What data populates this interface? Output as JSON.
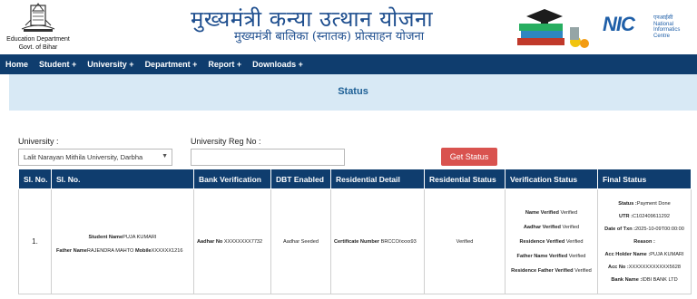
{
  "header": {
    "dept_line1": "Education Department",
    "dept_line2": "Govt. of Bihar",
    "title_main": "मुख्यमंत्री कन्या उत्थान योजना",
    "title_sub": "मुख्यमंत्री बालिका (स्नातक) प्रोत्साहन योजना",
    "nic_logo": "NIC",
    "nic_hindi": "एनआईसी",
    "nic_line1": "National",
    "nic_line2": "Informatics",
    "nic_line3": "Centre"
  },
  "nav": {
    "items": [
      "Home",
      "Student +",
      "University +",
      "Department +",
      "Report +",
      "Downloads +"
    ]
  },
  "page": {
    "title": "Status"
  },
  "form": {
    "university_label": "University :",
    "university_selected": "Lalit Narayan Mithila University, Darbha",
    "reg_label": "University Reg No :",
    "reg_value": "",
    "button": "Get Status"
  },
  "table": {
    "headers": [
      "Sl. No.",
      "Sl. No.",
      "Bank Verification",
      "DBT Enabled",
      "Residential Detail",
      "Residential Status",
      "Verification Status",
      "Final Status"
    ],
    "row": {
      "sl": "1.",
      "student_name_label": "Student Name",
      "student_name": "PUJA KUMARI",
      "father_name_label": "Father Name",
      "father_name": "RAJENDRA MAHTO",
      "mobile_label": "Mobile",
      "mobile": "XXXXXX1216",
      "aadhar_label": "Aadhar No",
      "aadhar": "XXXXXXXX7732",
      "dbt": "Aadhar Seeded",
      "cert_label": "Certificate Number",
      "cert": "BRCCO/xxxx93",
      "res_status": "Verified",
      "verification": [
        {
          "label": "Name Verified",
          "value": "Verified"
        },
        {
          "label": "Aadhar Verified",
          "value": "Verified"
        },
        {
          "label": "Residence Verified",
          "value": "Verified"
        },
        {
          "label": "Father Name Verified",
          "value": "Verified"
        },
        {
          "label": "Residence Father Verified",
          "value": "Verified"
        }
      ],
      "final": [
        {
          "label": "Status :",
          "value": "Payment Done"
        },
        {
          "label": "UTR :",
          "value": "C102409611292"
        },
        {
          "label": "Date of Txn :",
          "value": "2025-10-09T00:00:00"
        },
        {
          "label": "Reason :",
          "value": ""
        },
        {
          "label": "Acc Holder Name :",
          "value": "PUJA KUMARI"
        },
        {
          "label": "Acc No :",
          "value": "XXXXXXXXXXXX5628"
        },
        {
          "label": "Bank Name :",
          "value": "IDBI BANK LTD"
        }
      ]
    }
  },
  "colors": {
    "nav_bg": "#0f3d6e",
    "title_blue": "#1f4f8f",
    "status_band": "#d8e9f5",
    "button_red": "#d9534f"
  }
}
